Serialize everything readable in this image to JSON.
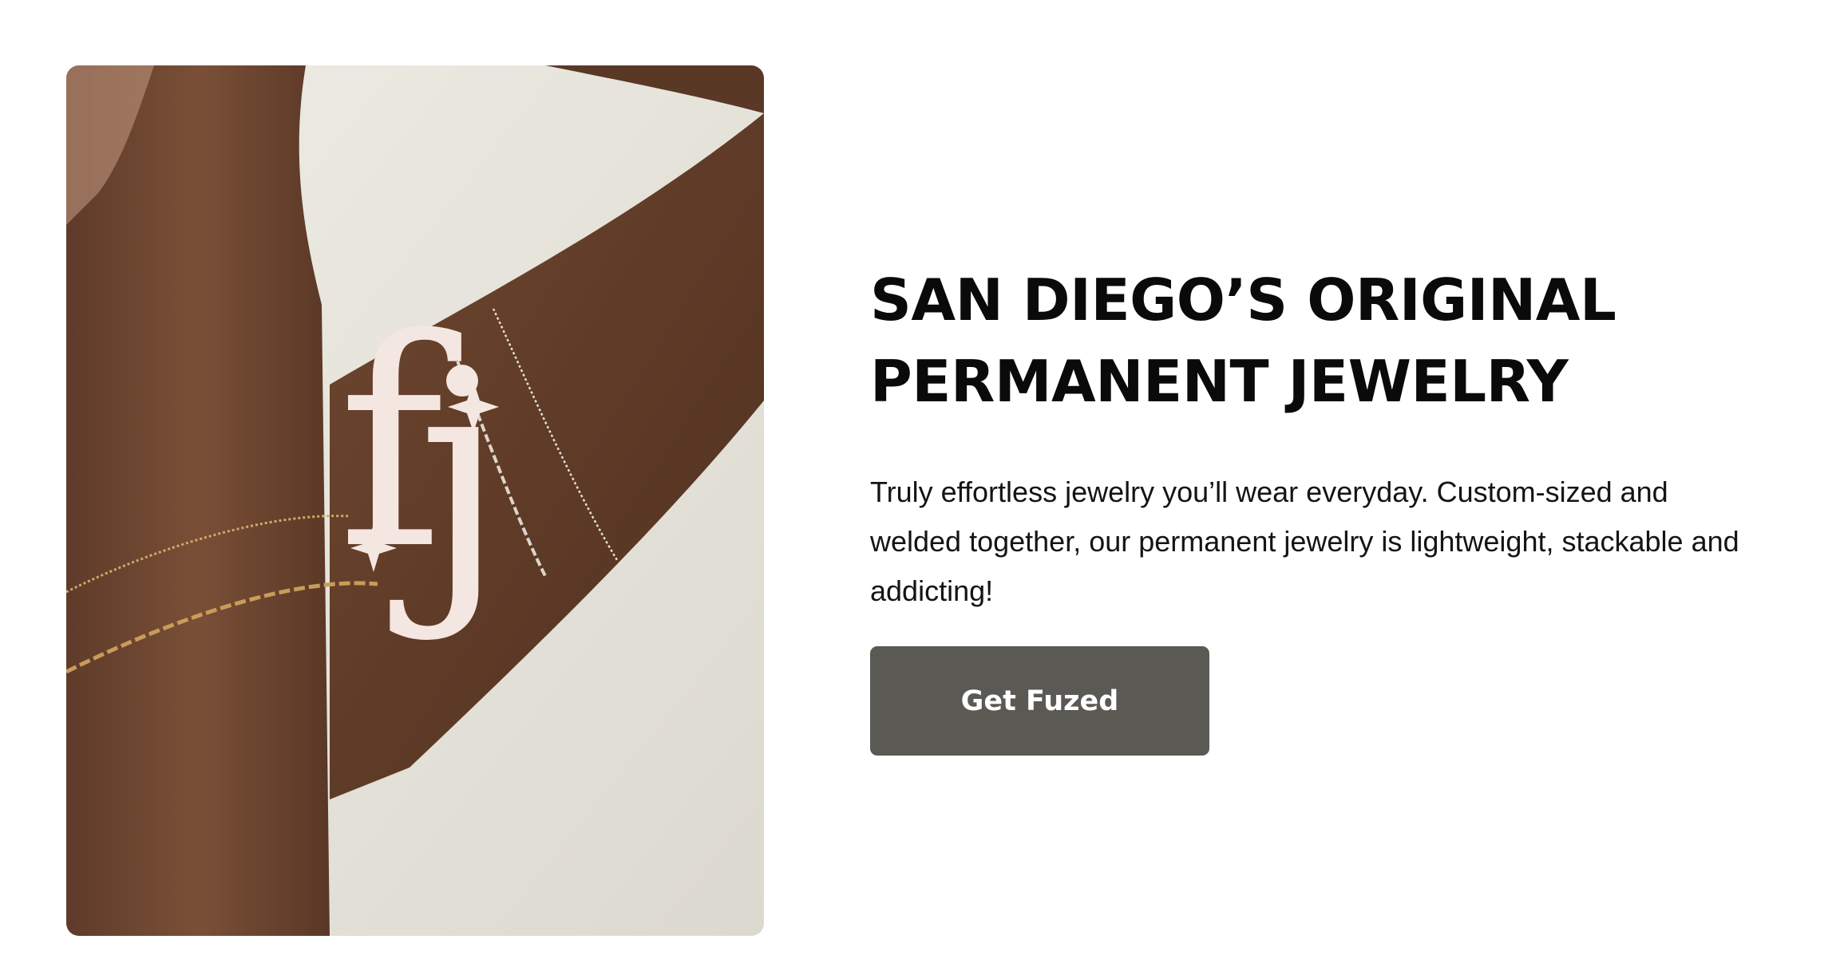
{
  "hero": {
    "image_label": "Two wrists wearing permanent chain bracelets",
    "logo_monogram": "fj",
    "colors": {
      "background": "#e9e7df",
      "skin": "#6b4430",
      "gold_chain": "#c9a062",
      "silver_chain": "#d9d4cc",
      "logo": "#f4e6e0"
    }
  },
  "headline": {
    "line1": "SAN DIEGO’S ORIGINAL",
    "line2": "PERMANENT JEWELRY"
  },
  "description": "Truly effortless jewelry you’ll wear everyday. Custom-sized and welded together, our permanent jewelry is lightweight, stackable and addicting!",
  "cta": {
    "label": "Get Fuzed",
    "color": "#5a5954"
  }
}
